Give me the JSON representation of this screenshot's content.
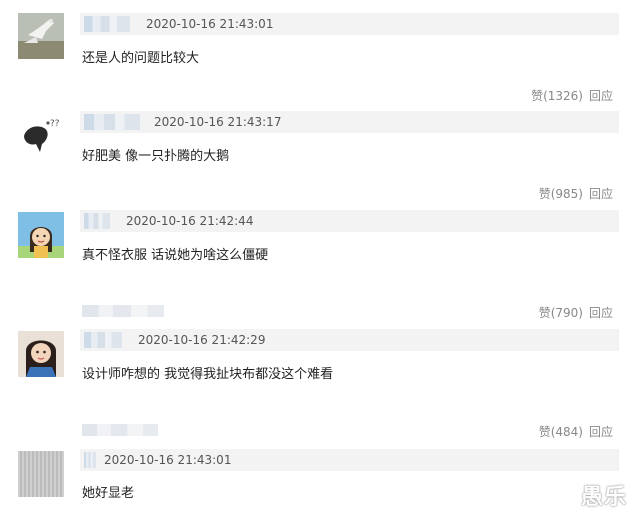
{
  "comments": [
    {
      "timestamp": "2020-10-16 21:43:01",
      "text": "还是人的问题比较大",
      "like_label": "赞",
      "like_count": "(1326)",
      "reply_label": "回应"
    },
    {
      "timestamp": "2020-10-16 21:43:17",
      "text": "好肥美 像一只扑腾的大鹅",
      "like_label": "赞",
      "like_count": "(985)",
      "reply_label": "回应"
    },
    {
      "timestamp": "2020-10-16 21:42:44",
      "text": "真不怪衣服 话说她为啥这么僵硬",
      "like_label": "赞",
      "like_count": "(790)",
      "reply_label": "回应"
    },
    {
      "timestamp": "2020-10-16 21:42:29",
      "text": "设计师咋想的 我觉得我扯块布都没这个难看",
      "like_label": "赞",
      "like_count": "(484)",
      "reply_label": "回应"
    },
    {
      "timestamp": "2020-10-16 21:43:01",
      "text": "她好显老"
    }
  ],
  "watermark": "愚乐",
  "colors": {
    "meta_bar": "#f3f3f3",
    "action_text": "#888888",
    "body_text": "#222222"
  }
}
